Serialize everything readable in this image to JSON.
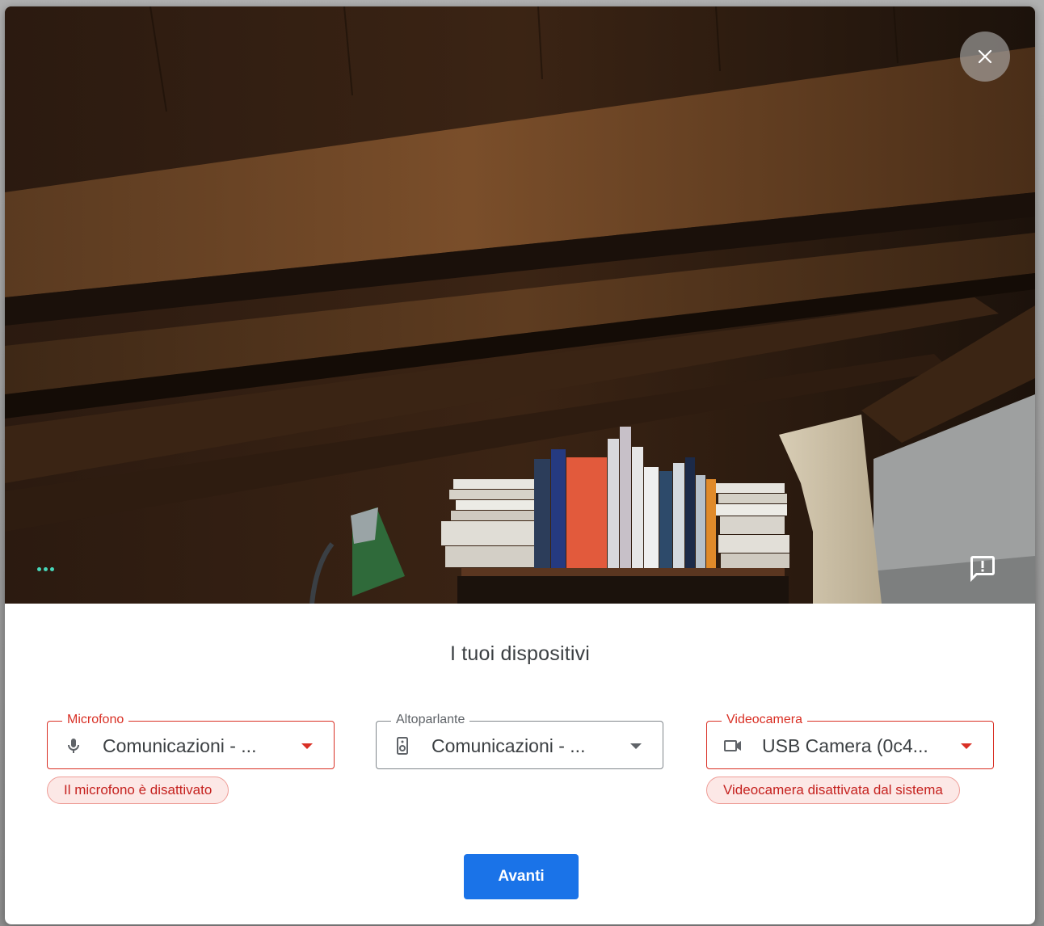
{
  "dialog": {
    "title": "I tuoi dispositivi",
    "close_icon": "close-icon",
    "feedback_icon": "feedback-icon",
    "more_icon": "three-dots-icon"
  },
  "devices": {
    "microphone": {
      "label": "Microfono",
      "value": "Comunicazioni - ...",
      "icon": "microphone-icon",
      "error": "Il microfono è disattivato"
    },
    "speaker": {
      "label": "Altoparlante",
      "value": "Comunicazioni - ...",
      "icon": "speaker-icon"
    },
    "camera": {
      "label": "Videocamera",
      "value": "USB Camera (0c4...",
      "icon": "videocam-icon",
      "error": "Videocamera disattivata dal sistema"
    }
  },
  "actions": {
    "next_label": "Avanti"
  },
  "colors": {
    "accent": "#1a73e8",
    "error": "#d93025",
    "error_bg": "#fce8e6",
    "dots": "#47d7b9"
  }
}
